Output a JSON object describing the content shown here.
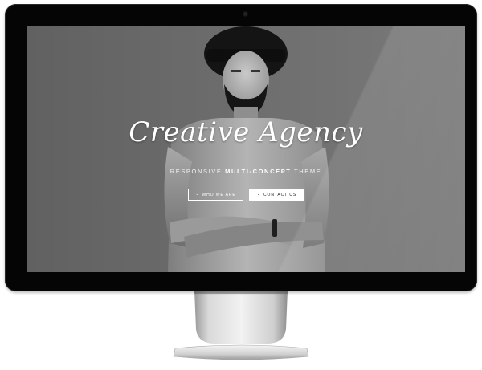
{
  "hero": {
    "title": "Creative Agency",
    "subtitle_prefix": "RESPONSIVE",
    "subtitle_bold": "MULTI-CONCEPT",
    "subtitle_suffix": "THEME",
    "buttons": [
      {
        "label": "WHO WE ARE",
        "icon": "chevron-down-icon",
        "style": "outline"
      },
      {
        "label": "CONTACT US",
        "icon": "chevron-down-icon",
        "style": "solid"
      }
    ]
  },
  "colors": {
    "screen_bg": "#6b6b6b",
    "bezel": "#050505",
    "text": "#ffffff",
    "button_solid_bg": "#ffffff",
    "button_solid_text": "#222222"
  }
}
